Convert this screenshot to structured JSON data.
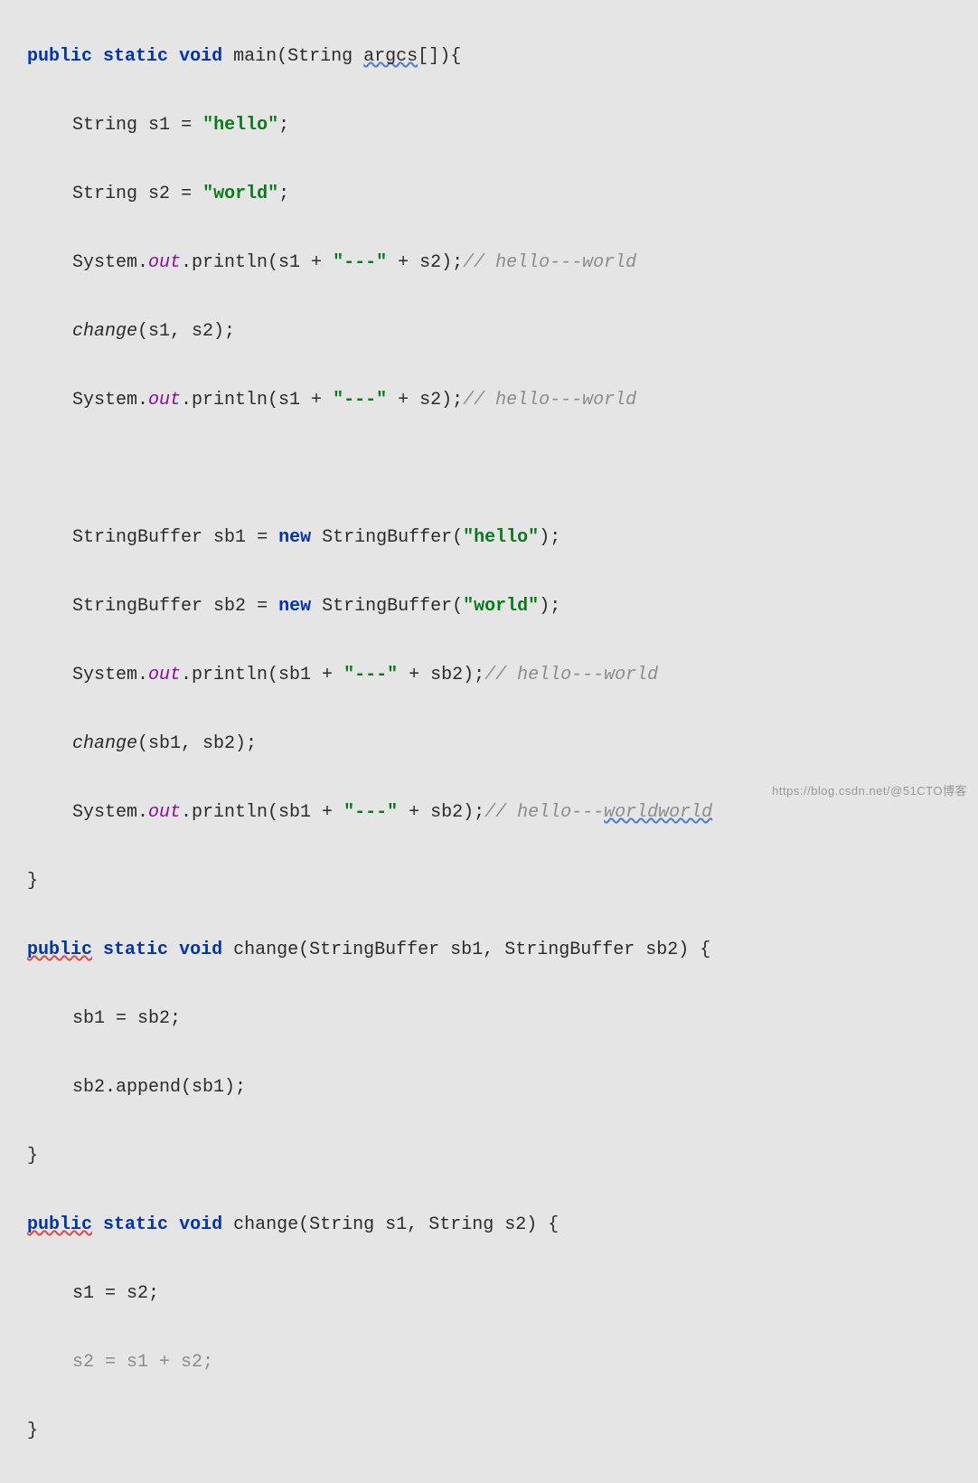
{
  "code": {
    "l1": {
      "kw1": "public",
      "kw2": "static",
      "kw3": "void",
      "fn": "main",
      "paren_open": "(",
      "type": "String",
      "param": "argcs",
      "brackets": "[]",
      "paren_close": ")",
      "brace": "{"
    },
    "l2": {
      "type": "String",
      "var": "s1",
      "eq": "=",
      "str": "\"hello\"",
      "semi": ";"
    },
    "l3": {
      "type": "String",
      "var": "s2",
      "eq": "=",
      "str": "\"world\"",
      "semi": ";"
    },
    "l4": {
      "sys": "System.",
      "out": "out",
      "rest": ".println(s1 + ",
      "str": "\"---\"",
      "plus": " + s2);",
      "comment": "// hello---world"
    },
    "l5": {
      "fn": "change",
      "args": "(s1, s2);"
    },
    "l6": {
      "sys": "System.",
      "out": "out",
      "rest": ".println(s1 + ",
      "str": "\"---\"",
      "plus": " + s2);",
      "comment": "// hello---world"
    },
    "l8": {
      "type": "StringBuffer",
      "var": "sb1",
      "eq": "=",
      "kw": "new",
      "ctor": "StringBuffer(",
      "str": "\"hello\"",
      "close": ");"
    },
    "l9": {
      "type": "StringBuffer",
      "var": "sb2",
      "eq": "=",
      "kw": "new",
      "ctor": "StringBuffer(",
      "str": "\"world\"",
      "close": ");"
    },
    "l10": {
      "sys": "System.",
      "out": "out",
      "rest": ".println(sb1 + ",
      "str": "\"---\"",
      "plus": " + sb2);",
      "comment": "// hello---world"
    },
    "l11": {
      "fn": "change",
      "args": "(sb1, sb2);"
    },
    "l12": {
      "sys": "System.",
      "out": "out",
      "rest": ".println(sb1 + ",
      "str": "\"---\"",
      "plus": " + sb2);",
      "comment_pre": "// hello---",
      "comment_wavy": "worldworld"
    },
    "l13": {
      "brace": "}"
    },
    "l14": {
      "kw1": "public",
      "kw2": "static",
      "kw3": "void",
      "fn": "change",
      "open": "(",
      "t1": "StringBuffer",
      "p1": "sb1",
      "comma": ",",
      "t2": "StringBuffer",
      "p2": "sb2",
      "close": ") {"
    },
    "l15": {
      "stmt": "sb1 = sb2;"
    },
    "l16": {
      "stmt": "sb2.append(sb1);"
    },
    "l17": {
      "brace": "}"
    },
    "l18": {
      "kw1": "public",
      "kw2": "static",
      "kw3": "void",
      "fn": "change",
      "open": "(",
      "t1": "String",
      "p1": "s1",
      "comma": ",",
      "t2": "String",
      "p2": "s2",
      "close": ") {"
    },
    "l19": {
      "stmt": "s1 = s2;"
    },
    "l20": {
      "stmt": "s2 = s1 + s2;"
    },
    "l21": {
      "brace": "}"
    }
  },
  "watermark": "https://blog.csdn.net/@51CTO博客"
}
